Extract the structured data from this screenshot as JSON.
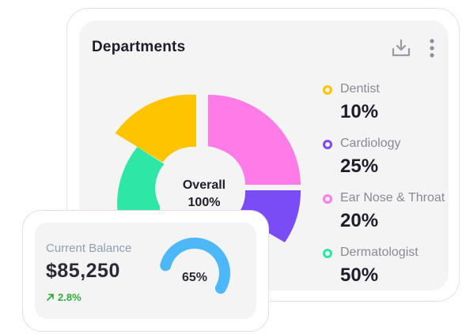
{
  "departments": {
    "title": "Departments",
    "actions": [
      "download-icon",
      "more-vertical-icon"
    ],
    "center_label": "Overall",
    "center_value": "100%",
    "items": [
      {
        "label": "Dentist",
        "value": "10%",
        "color": "#ffc400"
      },
      {
        "label": "Cardiology",
        "value": "25%",
        "color": "#7a4cf5"
      },
      {
        "label": "Ear Nose & Throat",
        "value": "20%",
        "color": "#ff7ce8"
      },
      {
        "label": "Dermatologist",
        "value": "50%",
        "color": "#2ee6a5"
      }
    ]
  },
  "balance": {
    "label": "Current Balance",
    "amount": "$85,250",
    "change": "2.8%",
    "change_icon": "arrow-up-right-icon",
    "gauge_value": "65%",
    "gauge_fraction": 0.65,
    "gauge_color": "#4db8f8"
  }
}
